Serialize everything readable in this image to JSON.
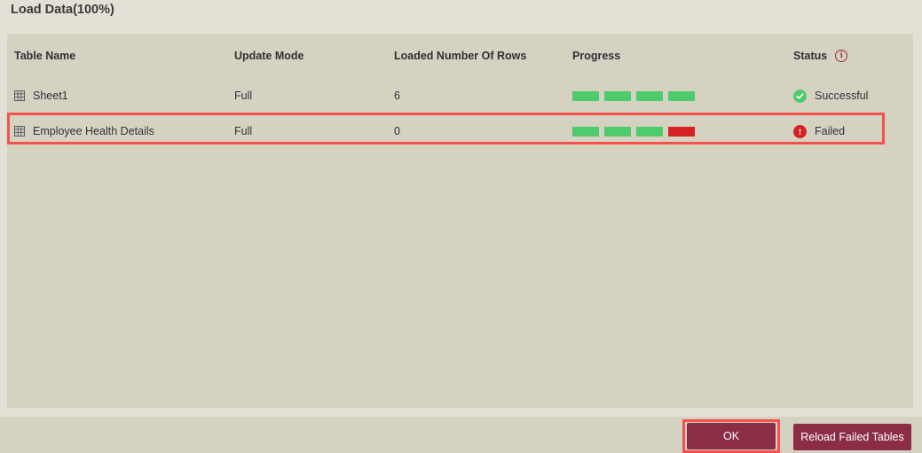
{
  "dialog": {
    "title": "Load Data(100%)"
  },
  "table": {
    "columns": [
      {
        "key": "table_name",
        "label": "Table Name"
      },
      {
        "key": "update_mode",
        "label": "Update Mode"
      },
      {
        "key": "rows",
        "label": "Loaded Number Of Rows"
      },
      {
        "key": "progress",
        "label": "Progress"
      },
      {
        "key": "status",
        "label": "Status"
      }
    ],
    "status_info_icon": "info-icon",
    "status_info_glyph": "i",
    "row_icon": "table-grid-icon",
    "rows": [
      {
        "table_name": "Sheet1",
        "update_mode": "Full",
        "rows": "6",
        "progress_segments": [
          "ok",
          "ok",
          "ok",
          "ok"
        ],
        "status": "Successful",
        "status_icon": "check-circle-icon",
        "highlighted": false
      },
      {
        "table_name": "Employee Health Details",
        "update_mode": "Full",
        "rows": "0",
        "progress_segments": [
          "ok",
          "ok",
          "ok",
          "fail"
        ],
        "status": "Failed",
        "status_icon": "exclamation-circle-icon",
        "highlighted": true
      }
    ]
  },
  "footer": {
    "ok_label": "OK",
    "reload_label": "Reload Failed Tables"
  },
  "colors": {
    "page_background": "#e3e0d6",
    "panel_background": "#d5d2c2",
    "button_primary": "#8b2d44",
    "progress_ok": "#4ecb6a",
    "progress_fail": "#d42222",
    "status_success": "#4ecb6a",
    "status_failed": "#d42222",
    "highlight_outline": "#f4514f",
    "text_primary": "#31313a",
    "info_icon": "#8e3046"
  }
}
